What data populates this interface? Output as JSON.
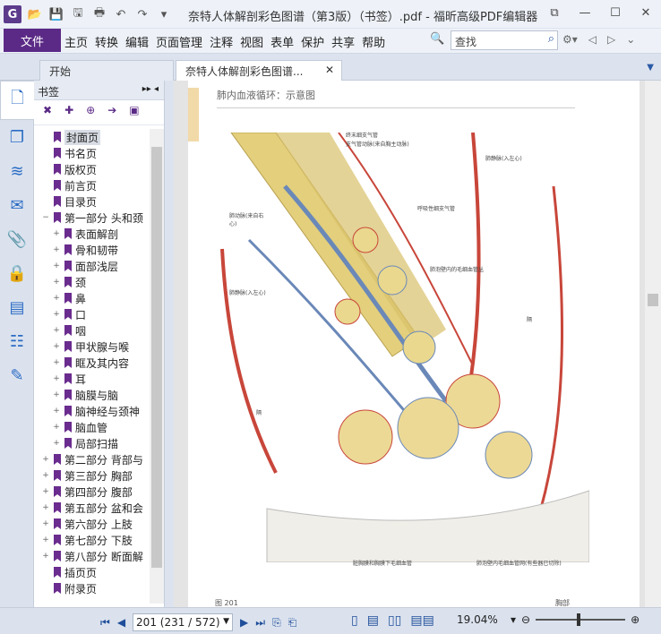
{
  "window": {
    "title": "奈特人体解剖彩色图谱（第3版）（书签）.pdf - 福昕高级PDF编辑器",
    "logo_letter": "G"
  },
  "ribbon": {
    "file_label": "文件",
    "menus": [
      "主页",
      "转换",
      "编辑",
      "页面管理",
      "注释",
      "视图",
      "表单",
      "保护",
      "共享",
      "帮助"
    ],
    "search_placeholder": "查找"
  },
  "tabs": {
    "start": "开始",
    "doc": "奈特人体解剖彩色图谱..."
  },
  "bookmarks": {
    "title": "书签",
    "items": [
      {
        "label": "封面页",
        "exp": "",
        "sel": true,
        "indent": 0
      },
      {
        "label": "书名页",
        "exp": "",
        "indent": 0
      },
      {
        "label": "版权页",
        "exp": "",
        "indent": 0
      },
      {
        "label": "前言页",
        "exp": "",
        "indent": 0
      },
      {
        "label": "目录页",
        "exp": "",
        "indent": 0
      },
      {
        "label": "第一部分 头和颈",
        "exp": "−",
        "indent": 0
      },
      {
        "label": "表面解剖",
        "exp": "+",
        "indent": 1
      },
      {
        "label": "骨和韧带",
        "exp": "+",
        "indent": 1
      },
      {
        "label": "面部浅层",
        "exp": "+",
        "indent": 1
      },
      {
        "label": "颈",
        "exp": "+",
        "indent": 1
      },
      {
        "label": "鼻",
        "exp": "+",
        "indent": 1
      },
      {
        "label": "口",
        "exp": "+",
        "indent": 1
      },
      {
        "label": "咽",
        "exp": "+",
        "indent": 1
      },
      {
        "label": "甲状腺与喉",
        "exp": "+",
        "indent": 1
      },
      {
        "label": "眶及其内容",
        "exp": "+",
        "indent": 1
      },
      {
        "label": "耳",
        "exp": "+",
        "indent": 1
      },
      {
        "label": "脑膜与脑",
        "exp": "+",
        "indent": 1
      },
      {
        "label": "脑神经与颈神",
        "exp": "+",
        "indent": 1
      },
      {
        "label": "脑血管",
        "exp": "+",
        "indent": 1
      },
      {
        "label": "局部扫描",
        "exp": "+",
        "indent": 1
      },
      {
        "label": "第二部分 背部与",
        "exp": "+",
        "indent": 0
      },
      {
        "label": "第三部分 胸部",
        "exp": "+",
        "indent": 0
      },
      {
        "label": "第四部分 腹部",
        "exp": "+",
        "indent": 0
      },
      {
        "label": "第五部分 盆和会",
        "exp": "+",
        "indent": 0
      },
      {
        "label": "第六部分 上肢",
        "exp": "+",
        "indent": 0
      },
      {
        "label": "第七部分 下肢",
        "exp": "+",
        "indent": 0
      },
      {
        "label": "第八部分 断面解",
        "exp": "+",
        "indent": 0
      },
      {
        "label": "插页页",
        "exp": "",
        "indent": 0
      },
      {
        "label": "附录页",
        "exp": "",
        "indent": 0
      }
    ]
  },
  "page": {
    "header": "肺内血液循环：示意图",
    "labels": {
      "a": "终末细支气管",
      "b": "支气管动脉(来自胸主动脉)",
      "c": "肺静脉(入左心)",
      "d": "肺动脉(来自右心)",
      "e": "呼吸性细支气管",
      "f": "肺静脉(入左心)",
      "g": "肺泡壁内的毛细血管丛",
      "h": "隔",
      "i": "隔",
      "j": "脏胸膜和胸膜下毛细血管",
      "k": "肺泡壁内毛细血管网(有些器已切除)"
    },
    "footer_left": "图 201",
    "footer_right": "胸部"
  },
  "status": {
    "page_value": "201 (231 / 572)",
    "zoom": "19.04%"
  },
  "colors": {
    "accent": "#5b2a86",
    "artery": "#c8463a",
    "vein": "#6a88b8",
    "bronchus": "#e3cf7c"
  }
}
